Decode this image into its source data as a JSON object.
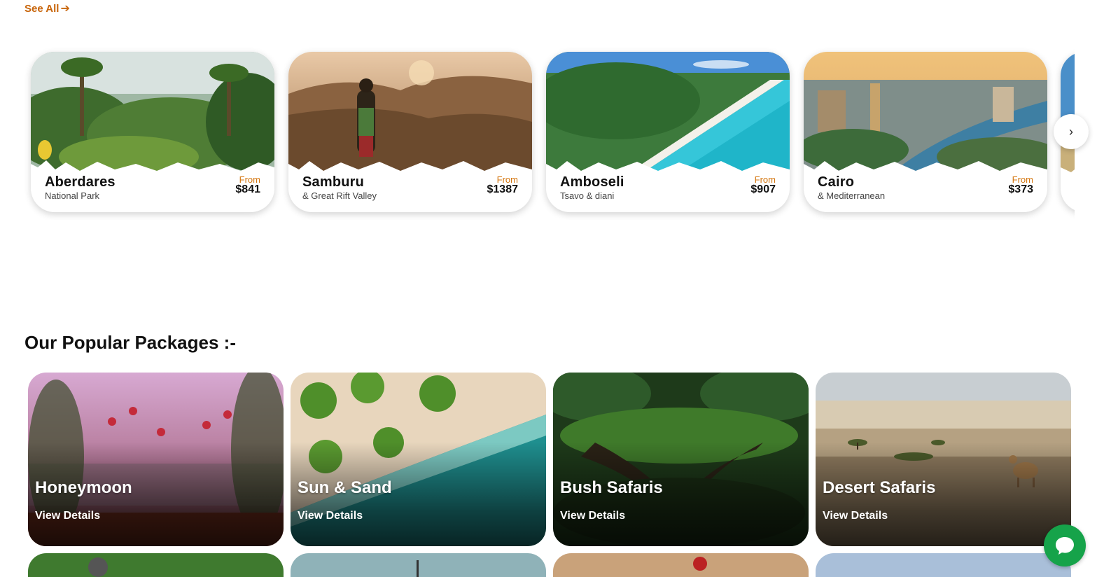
{
  "see_all": {
    "label": "See All",
    "icon": "arrow-right-icon"
  },
  "destinations": [
    {
      "name": "Aberdares",
      "subtitle": "National Park",
      "from_label": "From",
      "price": "$841"
    },
    {
      "name": "Samburu",
      "subtitle": "& Great Rift Valley",
      "from_label": "From",
      "price": "$1387"
    },
    {
      "name": "Amboseli",
      "subtitle": "Tsavo & diani",
      "from_label": "From",
      "price": "$907"
    },
    {
      "name": "Cairo",
      "subtitle": "& Mediterranean",
      "from_label": "From",
      "price": "$373"
    }
  ],
  "popular": {
    "title": "Our Popular Packages :-",
    "packages": [
      {
        "title": "Honeymoon",
        "link": "View Details"
      },
      {
        "title": "Sun & Sand",
        "link": "View Details"
      },
      {
        "title": "Bush Safaris",
        "link": "View Details"
      },
      {
        "title": "Desert Safaris",
        "link": "View Details"
      }
    ]
  },
  "colors": {
    "accent": "#c8650b",
    "chat": "#16a34a"
  },
  "icons": {
    "carousel_next": "chevron-right-icon",
    "chat": "chat-bubble-icon"
  }
}
